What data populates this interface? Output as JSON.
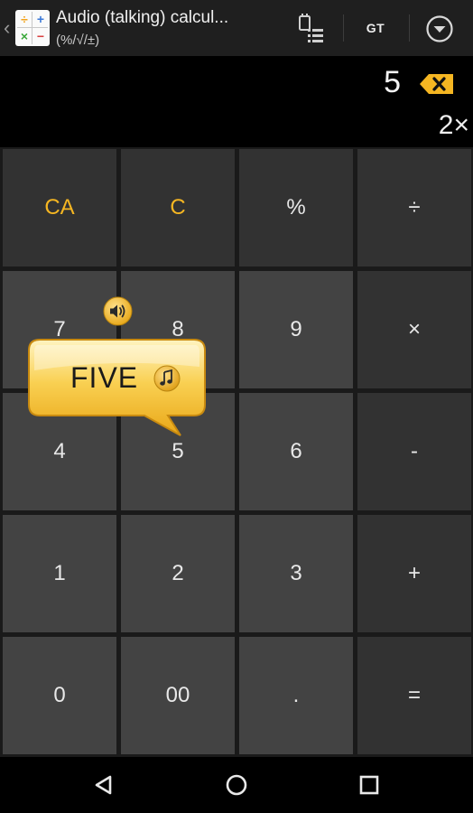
{
  "appbar": {
    "back_glyph": "‹",
    "title": "Audio (talking) calcul...",
    "subtitle": "(%/√/±)",
    "app_icon": {
      "tl": "÷",
      "tr": "+",
      "bl": "×",
      "br": "−"
    },
    "history_icon": "history-list-icon",
    "gt_label": "GT",
    "menu_icon": "chevron-down-circle-icon"
  },
  "display": {
    "value": "5",
    "memory": "2×",
    "backspace_icon": "backspace-icon",
    "accent_color": "#f5b622"
  },
  "keypad": {
    "keys": [
      {
        "label": "CA",
        "accent": true
      },
      {
        "label": "C",
        "accent": true
      },
      {
        "label": "%",
        "accent": false
      },
      {
        "label": "÷",
        "accent": false
      },
      {
        "label": "7",
        "accent": false
      },
      {
        "label": "8",
        "accent": false
      },
      {
        "label": "9",
        "accent": false
      },
      {
        "label": "×",
        "accent": false
      },
      {
        "label": "4",
        "accent": false
      },
      {
        "label": "5",
        "accent": false
      },
      {
        "label": "6",
        "accent": false
      },
      {
        "label": "-",
        "accent": false
      },
      {
        "label": "1",
        "accent": false
      },
      {
        "label": "2",
        "accent": false
      },
      {
        "label": "3",
        "accent": false
      },
      {
        "label": "+",
        "accent": false
      },
      {
        "label": "0",
        "accent": false
      },
      {
        "label": "00",
        "accent": false
      },
      {
        "label": ".",
        "accent": false
      },
      {
        "label": "=",
        "accent": false
      }
    ]
  },
  "speech_bubble": {
    "text": "FIVE",
    "music_icon": "music-note-icon",
    "speaker_icon": "speaker-icon",
    "color": "#f6c233"
  },
  "navbar": {
    "back_icon": "nav-back-icon",
    "home_icon": "nav-home-icon",
    "recents_icon": "nav-recents-icon"
  }
}
